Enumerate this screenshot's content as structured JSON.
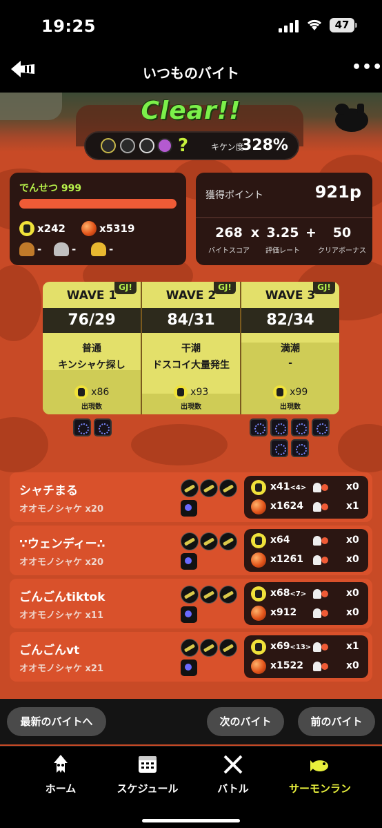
{
  "status": {
    "time": "19:25",
    "battery": "47"
  },
  "nav": {
    "title": "いつものバイト"
  },
  "result": {
    "clear": "Clear!!",
    "hazard_label": "キケン度",
    "hazard_value": "328%",
    "unknown_weapon": "?"
  },
  "title_rank": "でんせつ 999",
  "my_stats": {
    "golden": "x242",
    "power": "x5319",
    "scale_bronze": "-",
    "scale_silver": "-",
    "scale_gold": "-"
  },
  "points": {
    "label": "獲得ポイント",
    "value": "921p",
    "score": "268",
    "score_label": "バイトスコア",
    "times": "x",
    "rate": "3.25",
    "rate_label": "評価レート",
    "plus": "+",
    "bonus": "50",
    "bonus_label": "クリアボーナス"
  },
  "waves": [
    {
      "title": "WAVE 1",
      "score": "76/29",
      "tide": "普通",
      "event": "キンシャケ探し",
      "eggs": "x86",
      "eggs_label": "出現数",
      "gj": "GJ!"
    },
    {
      "title": "WAVE 2",
      "score": "84/31",
      "tide": "干潮",
      "event": "ドスコイ大量発生",
      "eggs": "x93",
      "eggs_label": "出現数",
      "gj": "GJ!"
    },
    {
      "title": "WAVE 3",
      "score": "82/34",
      "tide": "満潮",
      "event": "-",
      "eggs": "x99",
      "eggs_label": "出現数",
      "gj": "GJ!"
    }
  ],
  "players": [
    {
      "name": "シャチまる",
      "kills": "オオモノシャケ x20",
      "golden": "x41",
      "golden_assist": "<4>",
      "power": "x1624",
      "rescue": "x0",
      "rescued": "x1"
    },
    {
      "name": "∵ウェンディー∴",
      "kills": "オオモノシャケ x20",
      "golden": "x64",
      "golden_assist": "",
      "power": "x1261",
      "rescue": "x0",
      "rescued": "x0"
    },
    {
      "name": "ごんごんtiktok",
      "kills": "オオモノシャケ x11",
      "golden": "x68",
      "golden_assist": "<7>",
      "power": "x912",
      "rescue": "x0",
      "rescued": "x0"
    },
    {
      "name": "ごんごんvt",
      "kills": "オオモノシャケ x21",
      "golden": "x69",
      "golden_assist": "<13>",
      "power": "x1522",
      "rescue": "x1",
      "rescued": "x0"
    }
  ],
  "buttons": {
    "latest": "最新のバイトへ",
    "next": "次のバイト",
    "prev": "前のバイト"
  },
  "tabs": [
    {
      "label": "ホーム",
      "color": "#ffffff"
    },
    {
      "label": "スケジュール",
      "color": "#ffffff"
    },
    {
      "label": "バトル",
      "color": "#ffffff"
    },
    {
      "label": "サーモンラン",
      "color": "#e8f03c"
    }
  ],
  "colors": {
    "accent_green": "#7cf04a",
    "salmon_orange": "#d9512b",
    "wave_yellow": "#e3e06a",
    "active_tab": "#e8f03c"
  }
}
